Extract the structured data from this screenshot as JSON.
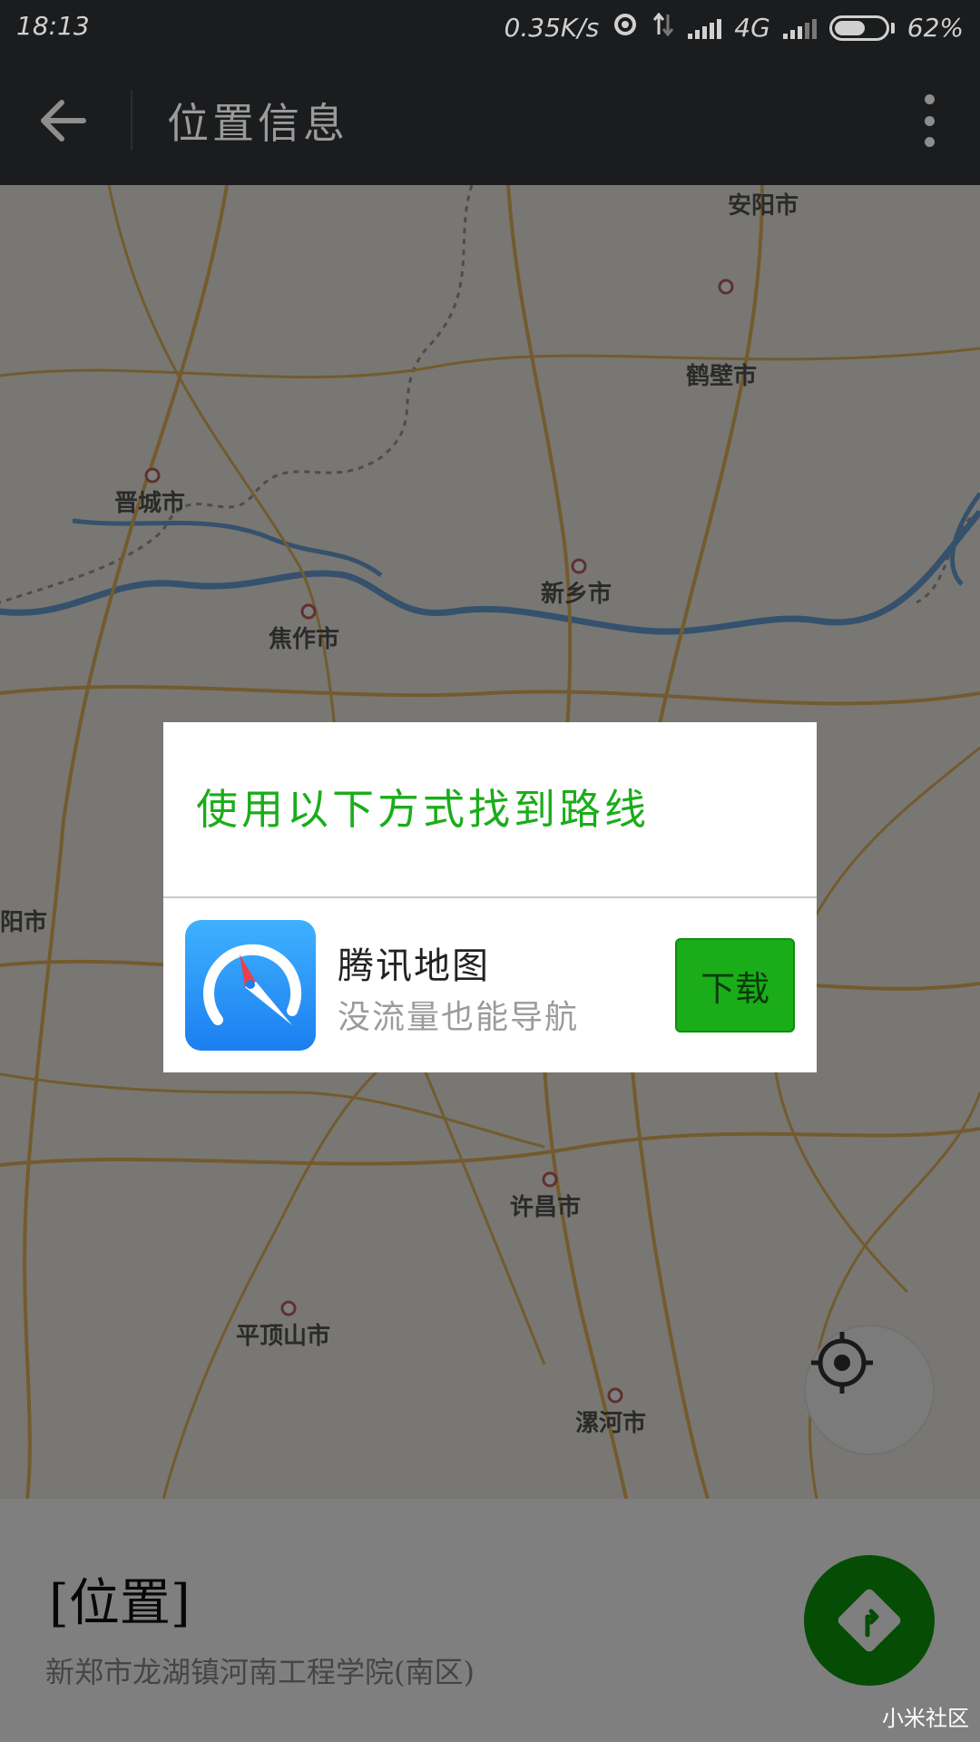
{
  "status_bar": {
    "time": "18:13",
    "net_speed": "0.35K/s",
    "network": "4G",
    "battery": "62%",
    "battery_level": 0.62
  },
  "app_bar": {
    "title": "位置信息",
    "back_icon": "arrow-left-icon",
    "more_icon": "more-vertical-icon"
  },
  "map": {
    "cities": [
      "安阳市",
      "鹤壁市",
      "晋城市",
      "新乡市",
      "焦作市",
      "阳市",
      "许昌市",
      "平顶山市",
      "漯河市"
    ],
    "locate_icon": "crosshair-icon"
  },
  "dialog": {
    "title": "使用以下方式找到路线",
    "app_name": "腾讯地图",
    "app_desc": "没流量也能导航",
    "download_label": "下载",
    "title_color": "#1aad19"
  },
  "bottom": {
    "title": "[位置]",
    "address": "新郑市龙湖镇河南工程学院(南区)",
    "nav_icon": "navigation-turn-icon"
  },
  "watermark": "小米社区"
}
